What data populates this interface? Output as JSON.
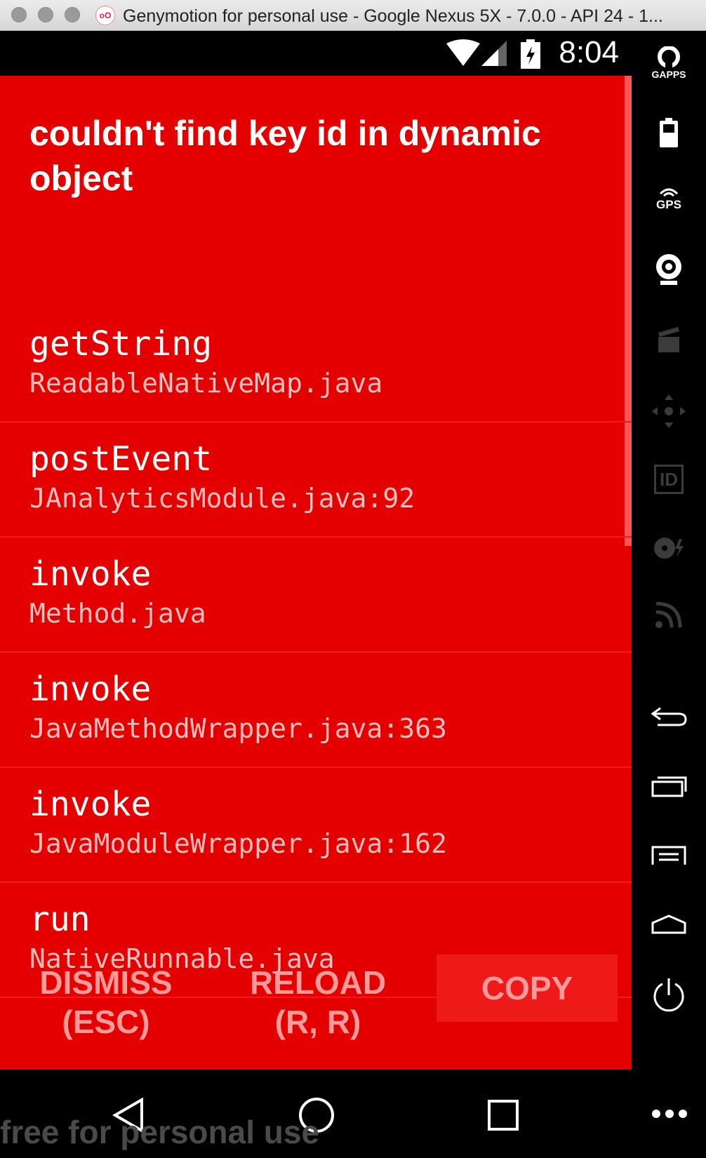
{
  "window": {
    "title": "Genymotion for personal use - Google Nexus 5X - 7.0.0 - API 24 - 1..."
  },
  "status_bar": {
    "time": "8:04"
  },
  "error": {
    "title": "couldn't find key id in dynamic object",
    "frames": [
      {
        "method": "getString",
        "file": "ReadableNativeMap.java"
      },
      {
        "method": "postEvent",
        "file": "JAnalyticsModule.java:92"
      },
      {
        "method": "invoke",
        "file": "Method.java"
      },
      {
        "method": "invoke",
        "file": "JavaMethodWrapper.java:363"
      },
      {
        "method": "invoke",
        "file": "JavaModuleWrapper.java:162"
      },
      {
        "method": "run",
        "file": "NativeRunnable.java"
      }
    ],
    "buttons": {
      "dismiss_line1": "DISMISS",
      "dismiss_line2": "(ESC)",
      "reload_line1": "RELOAD",
      "reload_line2": "(R, R)",
      "copy": "COPY"
    }
  },
  "sidebar": {
    "gapps_label": "GAPPS",
    "gps_label": "GPS",
    "id_label": "ID",
    "icons": [
      "gapps-icon",
      "battery-icon",
      "gps-icon",
      "camera-icon",
      "capture-icon",
      "dpad-icon",
      "identifiers-icon",
      "disk-icon",
      "cast-icon",
      "back-icon",
      "recent-apps-icon",
      "menu-icon",
      "home-icon",
      "power-icon"
    ]
  },
  "watermark": "free for personal use",
  "colors": {
    "error_red": "#e50000",
    "button_text": "#ff9a9a",
    "file_text": "#ffbdbd"
  }
}
